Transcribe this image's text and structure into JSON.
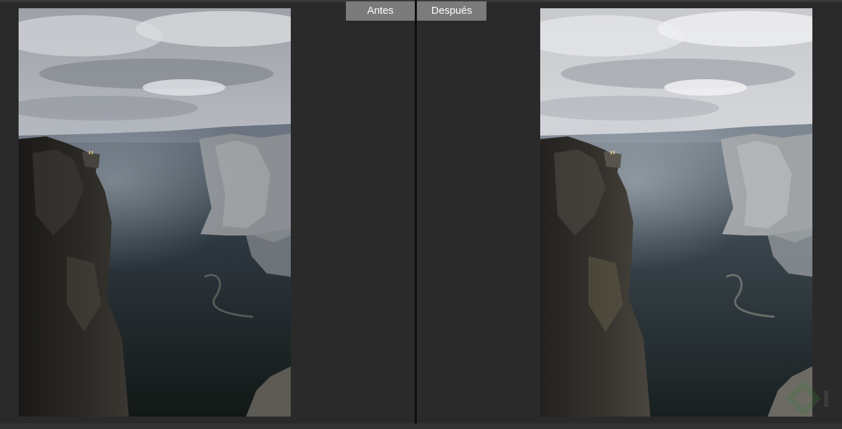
{
  "compare": {
    "before_label": "Antes",
    "after_label": "Después"
  },
  "colors": {
    "background": "#2a2a2a",
    "label_bg": "#7b7b7b",
    "divider": "#0d0d0d"
  }
}
